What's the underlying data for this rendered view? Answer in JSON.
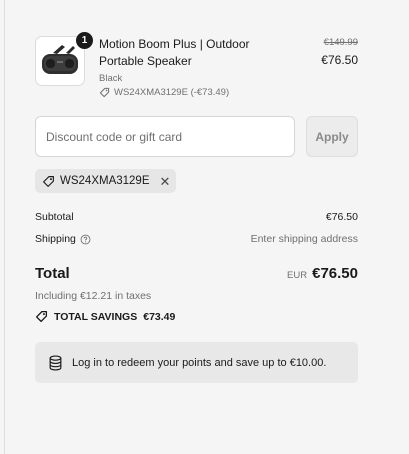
{
  "product": {
    "quantity": "1",
    "title": "Motion Boom Plus | Outdoor Portable Speaker",
    "variant": "Black",
    "discount_line": "WS24XMA3129E (-€73.49)",
    "compare_price": "€149.99",
    "price": "€76.50"
  },
  "discount": {
    "placeholder": "Discount code or gift card",
    "value": "",
    "apply_label": "Apply",
    "applied_code": "WS24XMA3129E"
  },
  "totals": {
    "subtotal_label": "Subtotal",
    "subtotal_value": "€76.50",
    "shipping_label": "Shipping",
    "shipping_value": "Enter shipping address",
    "total_label": "Total",
    "currency": "EUR",
    "total_value": "€76.50",
    "taxes_note": "Including €12.21 in taxes",
    "savings_label": "TOTAL SAVINGS",
    "savings_value": "€73.49"
  },
  "points_banner": {
    "text": "Log in to redeem your points and save up to €10.00."
  },
  "icons": {
    "thumbnail": "speaker-image",
    "discount": "tag-icon",
    "chip_remove": "close-icon",
    "shipping_help": "question-circle-icon",
    "savings": "tag-icon",
    "points": "coins-stack-icon"
  }
}
